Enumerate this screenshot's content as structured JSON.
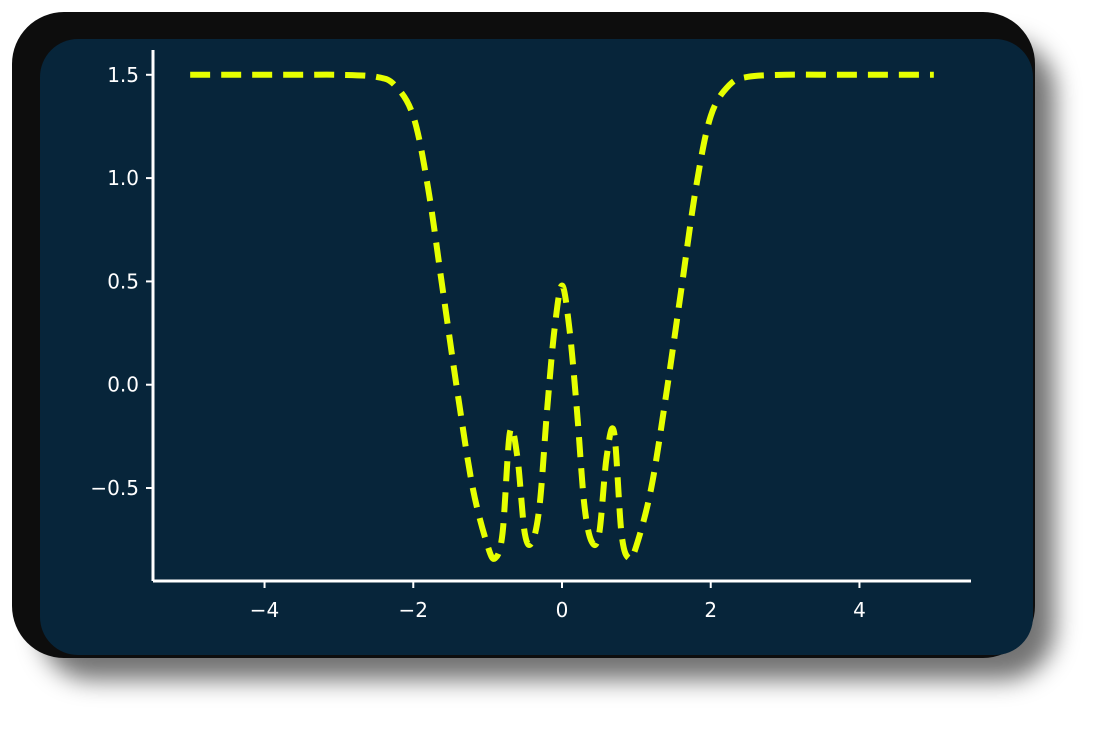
{
  "chart_data": {
    "type": "line",
    "title": "",
    "xlabel": "",
    "ylabel": "",
    "xlim": [
      -5.5,
      5.5
    ],
    "ylim": [
      -0.95,
      1.62
    ],
    "x_ticks": [
      -4,
      -2,
      0,
      2,
      4
    ],
    "x_tick_labels": [
      "−4",
      "−2",
      "0",
      "2",
      "4"
    ],
    "y_ticks": [
      -0.5,
      0.0,
      0.5,
      1.0,
      1.5
    ],
    "y_tick_labels": [
      "−0.5",
      "0.0",
      "0.5",
      "1.0",
      "1.5"
    ],
    "grid": false,
    "series": [
      {
        "line_style": "dashed",
        "color": "#e6ff00",
        "x": [
          -5.0,
          -4.5,
          -4.0,
          -3.5,
          -3.0,
          -2.5,
          -2.25,
          -2.0,
          -1.8,
          -1.6,
          -1.4,
          -1.2,
          -1.0,
          -0.9,
          -0.8,
          -0.7,
          -0.6,
          -0.5,
          -0.4,
          -0.3,
          -0.2,
          -0.1,
          0.0,
          0.1,
          0.2,
          0.3,
          0.4,
          0.5,
          0.6,
          0.7,
          0.8,
          0.9,
          1.0,
          1.2,
          1.4,
          1.6,
          1.8,
          2.0,
          2.25,
          2.5,
          3.0,
          3.5,
          4.0,
          4.5,
          5.0
        ],
        "y": [
          1.5,
          1.5,
          1.5,
          1.5,
          1.5,
          1.49,
          1.45,
          1.3,
          0.95,
          0.45,
          -0.05,
          -0.5,
          -0.78,
          -0.84,
          -0.72,
          -0.23,
          -0.35,
          -0.72,
          -0.76,
          -0.58,
          -0.12,
          0.27,
          0.48,
          0.27,
          -0.12,
          -0.58,
          -0.76,
          -0.72,
          -0.35,
          -0.23,
          -0.72,
          -0.84,
          -0.78,
          -0.5,
          -0.05,
          0.45,
          0.95,
          1.3,
          1.45,
          1.49,
          1.5,
          1.5,
          1.5,
          1.5,
          1.5
        ]
      }
    ]
  },
  "colors": {
    "card_frame": "#0d0d0d",
    "panel_background": "#07253a",
    "axes": "#ffffff",
    "line": "#e6ff00"
  }
}
